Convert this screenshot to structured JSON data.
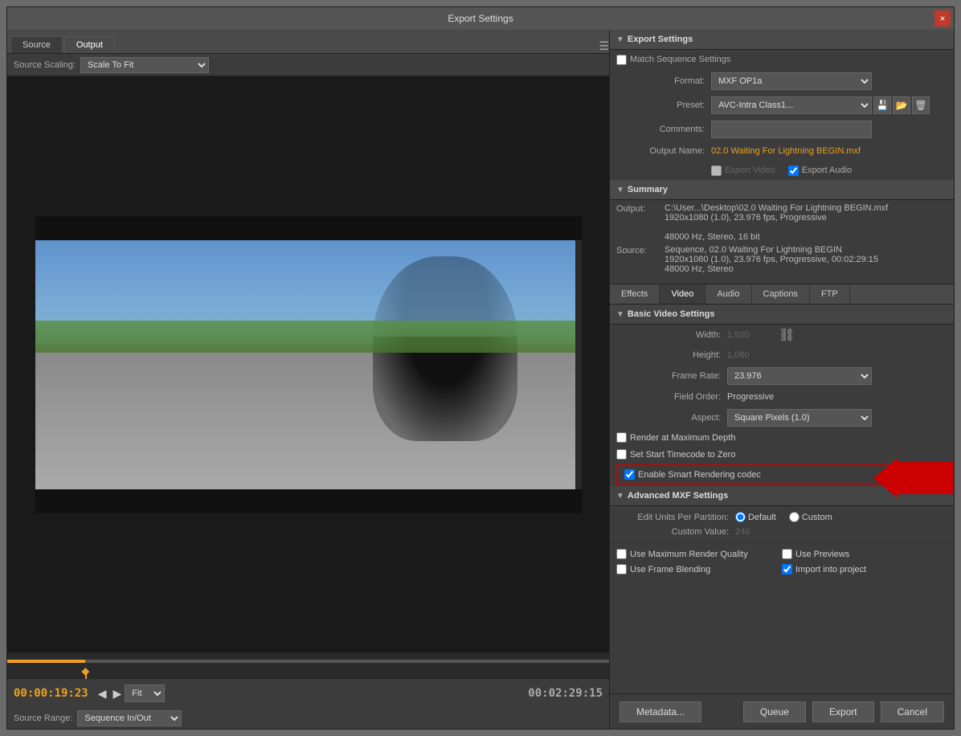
{
  "dialog": {
    "title": "Export Settings",
    "close_label": "×"
  },
  "left_panel": {
    "tabs": [
      {
        "label": "Source",
        "active": false
      },
      {
        "label": "Output",
        "active": true
      }
    ],
    "source_scaling": {
      "label": "Source Scaling:",
      "value": "Scale To Fit"
    },
    "timecode_start": "00:00:19:23",
    "timecode_end": "00:02:29:15",
    "fit_label": "Fit",
    "source_range": {
      "label": "Source Range:",
      "value": "Sequence In/Out"
    }
  },
  "export_settings": {
    "section_title": "Export Settings",
    "match_sequence_label": "Match Sequence Settings",
    "format_label": "Format:",
    "format_value": "MXF OP1a",
    "preset_label": "Preset:",
    "preset_value": "AVC-Intra Class1...",
    "comments_label": "Comments:",
    "output_name_label": "Output Name:",
    "output_name_value": "02.0 Waiting For Lightning BEGIN.mxf",
    "export_video_label": "Export Video",
    "export_audio_label": "Export Audio"
  },
  "summary": {
    "section_title": "Summary",
    "output_label": "Output:",
    "output_value": "C:\\User...\\Desktop\\02.0 Waiting For Lightning BEGIN.mxf\n1920x1080 (1.0), 23.976 fps, Progressive\n\n48000 Hz, Stereo, 16 bit",
    "source_label": "Source:",
    "source_value": "Sequence, 02.0 Waiting For Lightning BEGIN\n1920x1080 (1.0), 23.976 fps, Progressive, 00:02:29:15\n48000 Hz, Stereo"
  },
  "tabs": {
    "items": [
      "Effects",
      "Video",
      "Audio",
      "Captions",
      "FTP"
    ],
    "active": "Video"
  },
  "basic_video": {
    "section_title": "Basic Video Settings",
    "width_label": "Width:",
    "width_value": "1,920",
    "height_label": "Height:",
    "height_value": "1,080",
    "frame_rate_label": "Frame Rate:",
    "frame_rate_value": "23.976",
    "field_order_label": "Field Order:",
    "field_order_value": "Progressive",
    "aspect_label": "Aspect:",
    "aspect_value": "Square Pixels (1.0)",
    "render_max_label": "Render at Maximum Depth",
    "start_timecode_label": "Set Start Timecode to Zero",
    "smart_render_label": "Enable Smart Rendering codec"
  },
  "advanced_mxf": {
    "section_title": "Advanced MXF Settings",
    "edit_units_label": "Edit Units Per Partition:",
    "default_label": "Default",
    "custom_label": "Custom",
    "custom_value_label": "Custom Value:",
    "custom_value": "240"
  },
  "bottom_options": {
    "use_max_render": "Use Maximum Render Quality",
    "use_previews": "Use Previews",
    "use_frame_blending": "Use Frame Blending",
    "import_into_project": "Import into project"
  },
  "footer": {
    "metadata_label": "Metadata...",
    "queue_label": "Queue",
    "export_label": "Export",
    "cancel_label": "Cancel"
  }
}
